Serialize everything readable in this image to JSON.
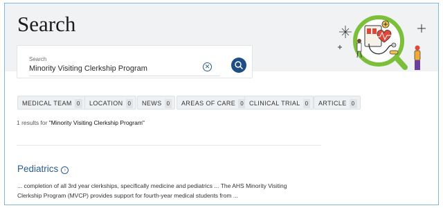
{
  "page": {
    "title": "Search"
  },
  "search": {
    "label": "Search",
    "value": "Minority Visiting Clerkship Program",
    "clear_icon": "clear-circle-icon",
    "submit_icon": "search-icon"
  },
  "filters": [
    {
      "label": "MEDICAL TEAM",
      "count": "0"
    },
    {
      "label": "LOCATION",
      "count": "0"
    },
    {
      "label": "NEWS",
      "count": "0"
    },
    {
      "label": "AREAS OF CARE",
      "count": "0"
    },
    {
      "label": "CLINICAL TRIAL",
      "count": "0"
    },
    {
      "label": "ARTICLE",
      "count": "0"
    }
  ],
  "results": {
    "count_prefix": "1 results for ",
    "query_quoted": "\"Minority Visiting Clerkship Program\"",
    "items": [
      {
        "title": "Pediatrics",
        "title_icon": "arrow-circle-right-icon",
        "snippet_line1": "... completion of all 3rd year clerkships, specifically medicine and pediatrics ... The AHS Minority Visiting",
        "snippet_line2": "Clerkship Program (MVCP) provides support for fourth-year medical students from ..."
      }
    ]
  },
  "colors": {
    "accent": "#1d4f86",
    "link": "#2a5b8f",
    "hero_bg": "#f0f2f4",
    "illustration_green": "#7bbf3a",
    "illustration_red": "#e0473a"
  }
}
